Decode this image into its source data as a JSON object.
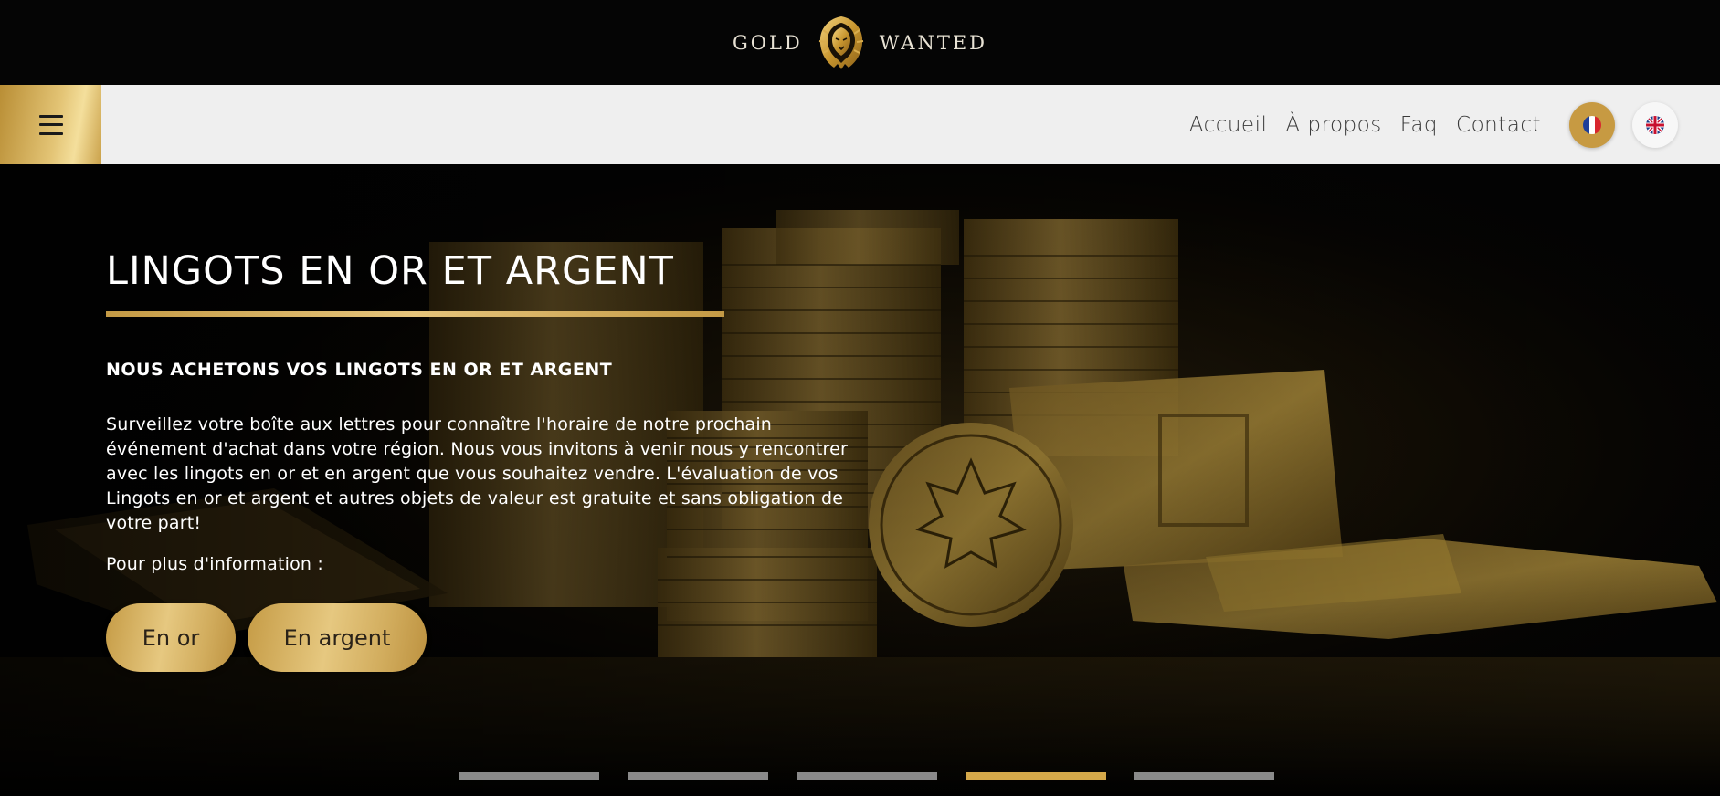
{
  "brand": {
    "word_left": "GOLD",
    "word_right": "WANTED",
    "logo_icon": "lion-head-icon",
    "accent_color": "#d4a84a"
  },
  "nav": {
    "menu_icon": "hamburger-menu-icon",
    "links": [
      {
        "label": "Accueil"
      },
      {
        "label": "À propos"
      },
      {
        "label": "Faq"
      },
      {
        "label": "Contact"
      }
    ],
    "languages": [
      {
        "name": "french-flag-icon",
        "active": true
      },
      {
        "name": "uk-flag-icon",
        "active": false
      }
    ]
  },
  "hero": {
    "title": "LINGOTS EN OR ET ARGENT",
    "subtitle": "NOUS ACHETONS VOS LINGOTS EN OR ET ARGENT",
    "body": "Surveillez votre boîte aux lettres pour connaître l'horaire de notre prochain événement d'achat dans votre région. Nous vous invitons à venir nous y rencontrer avec les lingots en or et en argent que vous souhaitez vendre. L'évaluation de vos Lingots en or et argent et autres objets de valeur est gratuite et sans obligation de votre part!",
    "info_text": "Pour plus d'information :",
    "buttons": [
      {
        "label": "En or"
      },
      {
        "label": "En argent"
      }
    ]
  },
  "slider": {
    "count": 5,
    "active_index": 3
  }
}
